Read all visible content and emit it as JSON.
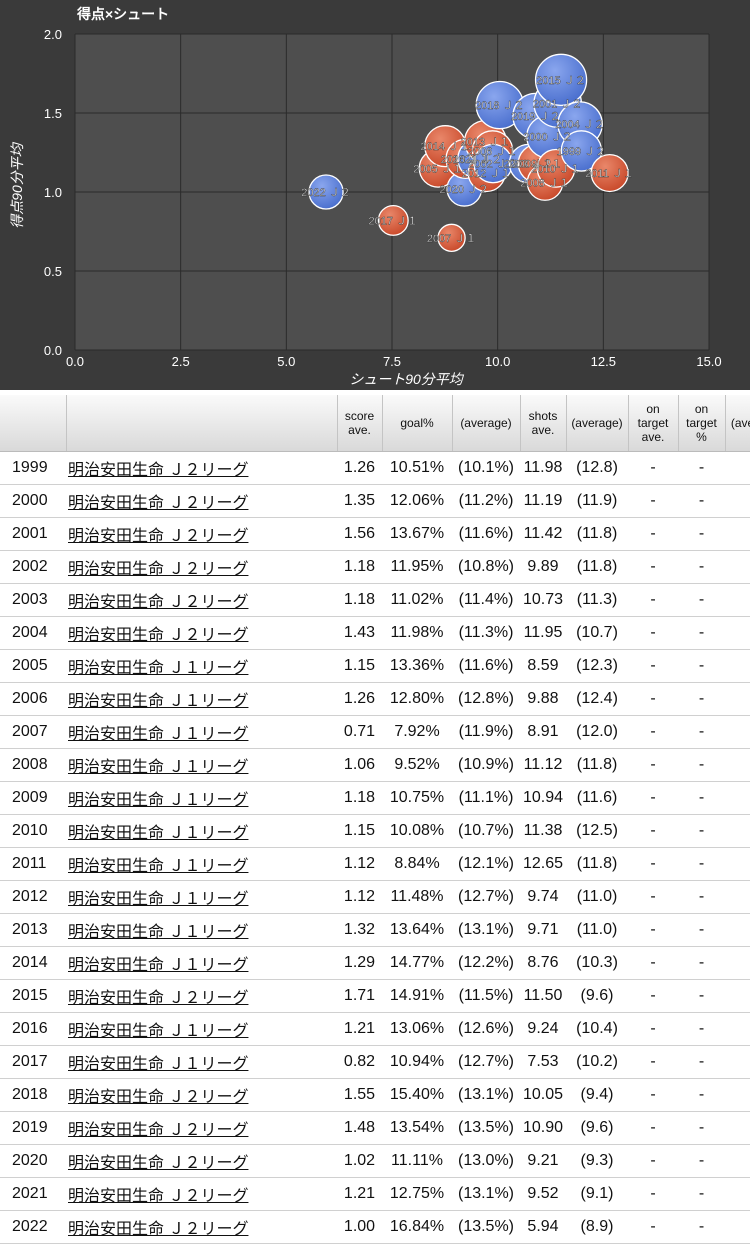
{
  "chart_data": {
    "type": "scatter",
    "title": "得点×シュート",
    "xlabel": "シュート90分平均",
    "ylabel": "得点90分平均",
    "xlim": [
      0,
      15
    ],
    "ylim": [
      0,
      2
    ],
    "xticks": [
      "0.0",
      "2.5",
      "5.0",
      "7.5",
      "10.0",
      "12.5",
      "15.0"
    ],
    "yticks": [
      "0.0",
      "0.5",
      "1.0",
      "1.5",
      "2.0"
    ],
    "grid": true,
    "colors": {
      "J1": "#c94a2b",
      "J2": "#4a6fce",
      "background": "#3a3a3a",
      "plot": "#4e4e4e"
    },
    "points": [
      {
        "label": "1999 Ｊ２",
        "x": 11.98,
        "y": 1.26,
        "league": "J2"
      },
      {
        "label": "2000 Ｊ２",
        "x": 11.19,
        "y": 1.35,
        "league": "J2"
      },
      {
        "label": "2001 Ｊ２",
        "x": 11.42,
        "y": 1.56,
        "league": "J2"
      },
      {
        "label": "2002 Ｊ２",
        "x": 9.89,
        "y": 1.18,
        "league": "J2"
      },
      {
        "label": "2003 Ｊ２",
        "x": 10.73,
        "y": 1.18,
        "league": "J2"
      },
      {
        "label": "2004 Ｊ２",
        "x": 11.95,
        "y": 1.43,
        "league": "J2"
      },
      {
        "label": "2005 Ｊ１",
        "x": 8.59,
        "y": 1.15,
        "league": "J1"
      },
      {
        "label": "2006 Ｊ１",
        "x": 9.88,
        "y": 1.26,
        "league": "J1"
      },
      {
        "label": "2007 Ｊ１",
        "x": 8.91,
        "y": 0.71,
        "league": "J1"
      },
      {
        "label": "2008 Ｊ１",
        "x": 11.12,
        "y": 1.06,
        "league": "J1"
      },
      {
        "label": "2009 Ｊ１",
        "x": 10.94,
        "y": 1.18,
        "league": "J1"
      },
      {
        "label": "2010 Ｊ１",
        "x": 11.38,
        "y": 1.15,
        "league": "J1"
      },
      {
        "label": "2011 Ｊ１",
        "x": 12.65,
        "y": 1.12,
        "league": "J1"
      },
      {
        "label": "2012 Ｊ１",
        "x": 9.74,
        "y": 1.12,
        "league": "J1"
      },
      {
        "label": "2013 Ｊ１",
        "x": 9.71,
        "y": 1.32,
        "league": "J1"
      },
      {
        "label": "2014 Ｊ１",
        "x": 8.76,
        "y": 1.29,
        "league": "J1"
      },
      {
        "label": "2015 Ｊ２",
        "x": 11.5,
        "y": 1.71,
        "league": "J2"
      },
      {
        "label": "2016 Ｊ１",
        "x": 9.24,
        "y": 1.21,
        "league": "J1"
      },
      {
        "label": "2017 Ｊ１",
        "x": 7.53,
        "y": 0.82,
        "league": "J1"
      },
      {
        "label": "2018 Ｊ２",
        "x": 10.05,
        "y": 1.55,
        "league": "J2"
      },
      {
        "label": "2019 Ｊ２",
        "x": 10.9,
        "y": 1.48,
        "league": "J2"
      },
      {
        "label": "2020 Ｊ２",
        "x": 9.21,
        "y": 1.02,
        "league": "J2"
      },
      {
        "label": "2021 Ｊ２",
        "x": 9.52,
        "y": 1.21,
        "league": "J2"
      },
      {
        "label": "2022 Ｊ２",
        "x": 5.94,
        "y": 1.0,
        "league": "J2"
      }
    ]
  },
  "table": {
    "headers": [
      "",
      "",
      "score ave.",
      "goal%",
      "(average)",
      "shots ave.",
      "(average)",
      "on target ave.",
      "on target %",
      "(ave"
    ],
    "rows": [
      [
        "1999",
        "明治安田生命 Ｊ２リーグ",
        "1.26",
        "10.51%",
        "(10.1%)",
        "11.98",
        "(12.8)",
        "-",
        "-",
        ""
      ],
      [
        "2000",
        "明治安田生命 Ｊ２リーグ",
        "1.35",
        "12.06%",
        "(11.2%)",
        "11.19",
        "(11.9)",
        "-",
        "-",
        ""
      ],
      [
        "2001",
        "明治安田生命 Ｊ２リーグ",
        "1.56",
        "13.67%",
        "(11.6%)",
        "11.42",
        "(11.8)",
        "-",
        "-",
        ""
      ],
      [
        "2002",
        "明治安田生命 Ｊ２リーグ",
        "1.18",
        "11.95%",
        "(10.8%)",
        "9.89",
        "(11.8)",
        "-",
        "-",
        ""
      ],
      [
        "2003",
        "明治安田生命 Ｊ２リーグ",
        "1.18",
        "11.02%",
        "(11.4%)",
        "10.73",
        "(11.3)",
        "-",
        "-",
        ""
      ],
      [
        "2004",
        "明治安田生命 Ｊ２リーグ",
        "1.43",
        "11.98%",
        "(11.3%)",
        "11.95",
        "(10.7)",
        "-",
        "-",
        ""
      ],
      [
        "2005",
        "明治安田生命 Ｊ１リーグ",
        "1.15",
        "13.36%",
        "(11.6%)",
        "8.59",
        "(12.3)",
        "-",
        "-",
        ""
      ],
      [
        "2006",
        "明治安田生命 Ｊ１リーグ",
        "1.26",
        "12.80%",
        "(12.8%)",
        "9.88",
        "(12.4)",
        "-",
        "-",
        ""
      ],
      [
        "2007",
        "明治安田生命 Ｊ１リーグ",
        "0.71",
        "7.92%",
        "(11.9%)",
        "8.91",
        "(12.0)",
        "-",
        "-",
        ""
      ],
      [
        "2008",
        "明治安田生命 Ｊ１リーグ",
        "1.06",
        "9.52%",
        "(10.9%)",
        "11.12",
        "(11.8)",
        "-",
        "-",
        ""
      ],
      [
        "2009",
        "明治安田生命 Ｊ１リーグ",
        "1.18",
        "10.75%",
        "(11.1%)",
        "10.94",
        "(11.6)",
        "-",
        "-",
        ""
      ],
      [
        "2010",
        "明治安田生命 Ｊ１リーグ",
        "1.15",
        "10.08%",
        "(10.7%)",
        "11.38",
        "(12.5)",
        "-",
        "-",
        ""
      ],
      [
        "2011",
        "明治安田生命 Ｊ１リーグ",
        "1.12",
        "8.84%",
        "(12.1%)",
        "12.65",
        "(11.8)",
        "-",
        "-",
        ""
      ],
      [
        "2012",
        "明治安田生命 Ｊ１リーグ",
        "1.12",
        "11.48%",
        "(12.7%)",
        "9.74",
        "(11.0)",
        "-",
        "-",
        ""
      ],
      [
        "2013",
        "明治安田生命 Ｊ１リーグ",
        "1.32",
        "13.64%",
        "(13.1%)",
        "9.71",
        "(11.0)",
        "-",
        "-",
        ""
      ],
      [
        "2014",
        "明治安田生命 Ｊ１リーグ",
        "1.29",
        "14.77%",
        "(12.2%)",
        "8.76",
        "(10.3)",
        "-",
        "-",
        ""
      ],
      [
        "2015",
        "明治安田生命 Ｊ２リーグ",
        "1.71",
        "14.91%",
        "(11.5%)",
        "11.50",
        "(9.6)",
        "-",
        "-",
        ""
      ],
      [
        "2016",
        "明治安田生命 Ｊ１リーグ",
        "1.21",
        "13.06%",
        "(12.6%)",
        "9.24",
        "(10.4)",
        "-",
        "-",
        ""
      ],
      [
        "2017",
        "明治安田生命 Ｊ１リーグ",
        "0.82",
        "10.94%",
        "(12.7%)",
        "7.53",
        "(10.2)",
        "-",
        "-",
        ""
      ],
      [
        "2018",
        "明治安田生命 Ｊ２リーグ",
        "1.55",
        "15.40%",
        "(13.1%)",
        "10.05",
        "(9.4)",
        "-",
        "-",
        ""
      ],
      [
        "2019",
        "明治安田生命 Ｊ２リーグ",
        "1.48",
        "13.54%",
        "(13.5%)",
        "10.90",
        "(9.6)",
        "-",
        "-",
        ""
      ],
      [
        "2020",
        "明治安田生命 Ｊ２リーグ",
        "1.02",
        "11.11%",
        "(13.0%)",
        "9.21",
        "(9.3)",
        "-",
        "-",
        ""
      ],
      [
        "2021",
        "明治安田生命 Ｊ２リーグ",
        "1.21",
        "12.75%",
        "(13.1%)",
        "9.52",
        "(9.1)",
        "-",
        "-",
        ""
      ],
      [
        "2022",
        "明治安田生命 Ｊ２リーグ",
        "1.00",
        "16.84%",
        "(13.5%)",
        "5.94",
        "(8.9)",
        "-",
        "-",
        ""
      ]
    ]
  }
}
